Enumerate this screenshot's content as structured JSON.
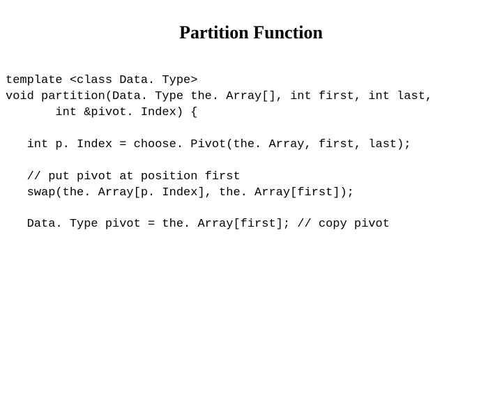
{
  "title": "Partition Function",
  "code": {
    "line1": "template <class Data. Type>",
    "line2": "void partition(Data. Type the. Array[], int first, int last,",
    "line3": "       int &pivot. Index) {",
    "line4": "",
    "line5": "   int p. Index = choose. Pivot(the. Array, first, last);",
    "line6": "",
    "line7": "   // put pivot at position first",
    "line8": "   swap(the. Array[p. Index], the. Array[first]);",
    "line9": "",
    "line10": "   Data. Type pivot = the. Array[first]; // copy pivot"
  }
}
